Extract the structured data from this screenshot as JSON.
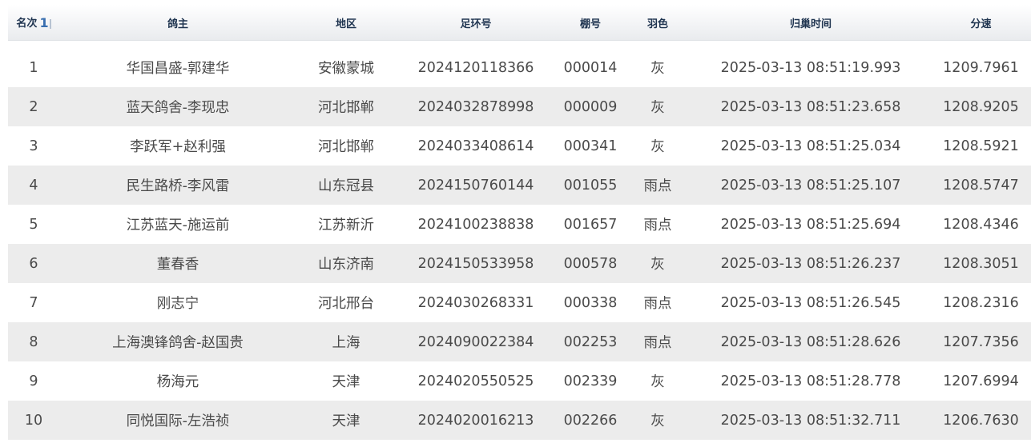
{
  "table": {
    "columns": [
      "名次",
      "鸽主",
      "地区",
      "足环号",
      "棚号",
      "羽色",
      "归巢时间",
      "分速"
    ],
    "sort_indicator": "1",
    "rows": [
      [
        "1",
        "华国昌盛-郭建华",
        "安徽蒙城",
        "2024120118366",
        "000014",
        "灰",
        "2025-03-13 08:51:19.993",
        "1209.7961"
      ],
      [
        "2",
        "蓝天鸽舍-李现忠",
        "河北邯郸",
        "2024032878998",
        "000009",
        "灰",
        "2025-03-13 08:51:23.658",
        "1208.9205"
      ],
      [
        "3",
        "李跃军+赵利强",
        "河北邯郸",
        "2024033408614",
        "000341",
        "灰",
        "2025-03-13 08:51:25.034",
        "1208.5921"
      ],
      [
        "4",
        "民生路桥-李风雷",
        "山东冠县",
        "2024150760144",
        "001055",
        "雨点",
        "2025-03-13 08:51:25.107",
        "1208.5747"
      ],
      [
        "5",
        "江苏蓝天-施运前",
        "江苏新沂",
        "2024100238838",
        "001657",
        "雨点",
        "2025-03-13 08:51:25.694",
        "1208.4346"
      ],
      [
        "6",
        "董春香",
        "山东济南",
        "2024150533958",
        "000578",
        "灰",
        "2025-03-13 08:51:26.237",
        "1208.3051"
      ],
      [
        "7",
        "刚志宁",
        "河北邢台",
        "2024030268331",
        "000338",
        "雨点",
        "2025-03-13 08:51:26.545",
        "1208.2316"
      ],
      [
        "8",
        "上海澳锋鸽舍-赵国贵",
        "上海",
        "2024090022384",
        "002253",
        "雨点",
        "2025-03-13 08:51:28.626",
        "1207.7356"
      ],
      [
        "9",
        "杨海元",
        "天津",
        "2024020550525",
        "002339",
        "灰",
        "2025-03-13 08:51:28.778",
        "1207.6994"
      ],
      [
        "10",
        "同悦国际-左浩祯",
        "天津",
        "2024020016213",
        "002266",
        "灰",
        "2025-03-13 08:51:32.711",
        "1206.7630"
      ]
    ]
  }
}
